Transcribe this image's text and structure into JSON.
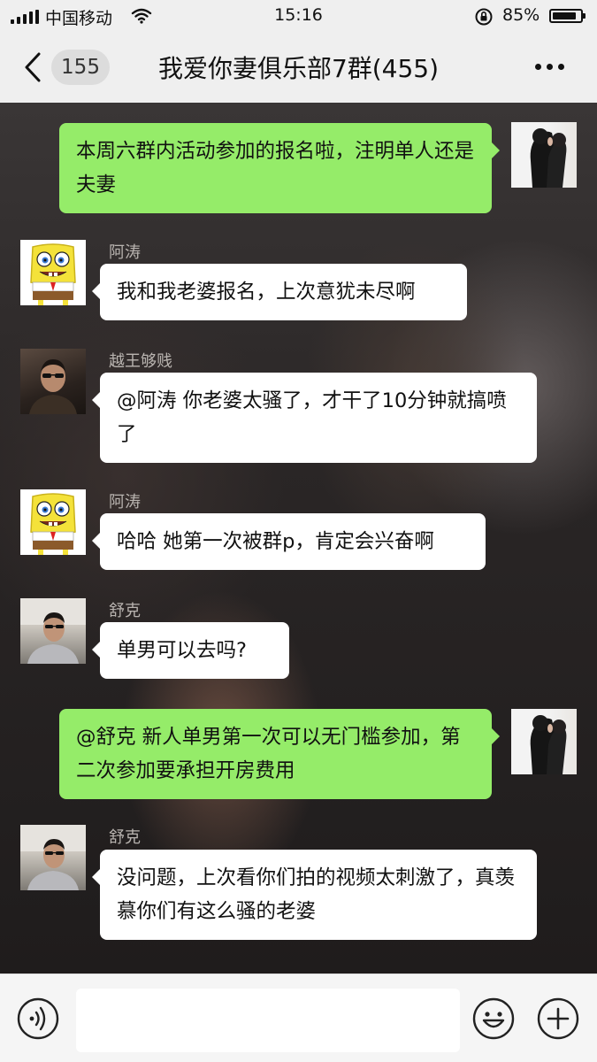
{
  "status_bar": {
    "carrier": "中国移动",
    "time": "15:16",
    "battery_percent_label": "85%",
    "battery_level": 0.85
  },
  "nav": {
    "unread_count": "155",
    "title": "我爱你妻俱乐部7群(455)"
  },
  "messages": [
    {
      "side": "out",
      "sender": "",
      "avatar": "couple-photo",
      "text": "本周六群内活动参加的报名啦，注明单人还是夫妻"
    },
    {
      "side": "in",
      "sender": "阿涛",
      "avatar": "spongebob",
      "text": "我和我老婆报名，上次意犹未尽啊"
    },
    {
      "side": "in",
      "sender": "越王够贱",
      "avatar": "man-sunglasses-photo",
      "text": "@阿涛 你老婆太骚了，才干了10分钟就搞喷了"
    },
    {
      "side": "in",
      "sender": "阿涛",
      "avatar": "spongebob",
      "text": "哈哈 她第一次被群p，肯定会兴奋啊"
    },
    {
      "side": "in",
      "sender": "舒克",
      "avatar": "man-car-photo",
      "text": "单男可以去吗?"
    },
    {
      "side": "out",
      "sender": "",
      "avatar": "couple-photo",
      "text": "@舒克 新人单男第一次可以无门槛参加，第二次参加要承担开房费用"
    },
    {
      "side": "in",
      "sender": "舒克",
      "avatar": "man-car-photo",
      "text": "没问题，上次看你们拍的视频太刺激了，真羡慕你们有这么骚的老婆"
    }
  ],
  "input_bar": {
    "placeholder": "",
    "icons": [
      "voice-icon",
      "emoji-icon",
      "plus-icon"
    ]
  },
  "colors": {
    "bubble_out": "#95ec69",
    "bubble_in": "#ffffff",
    "bar_bg": "#efefef"
  }
}
